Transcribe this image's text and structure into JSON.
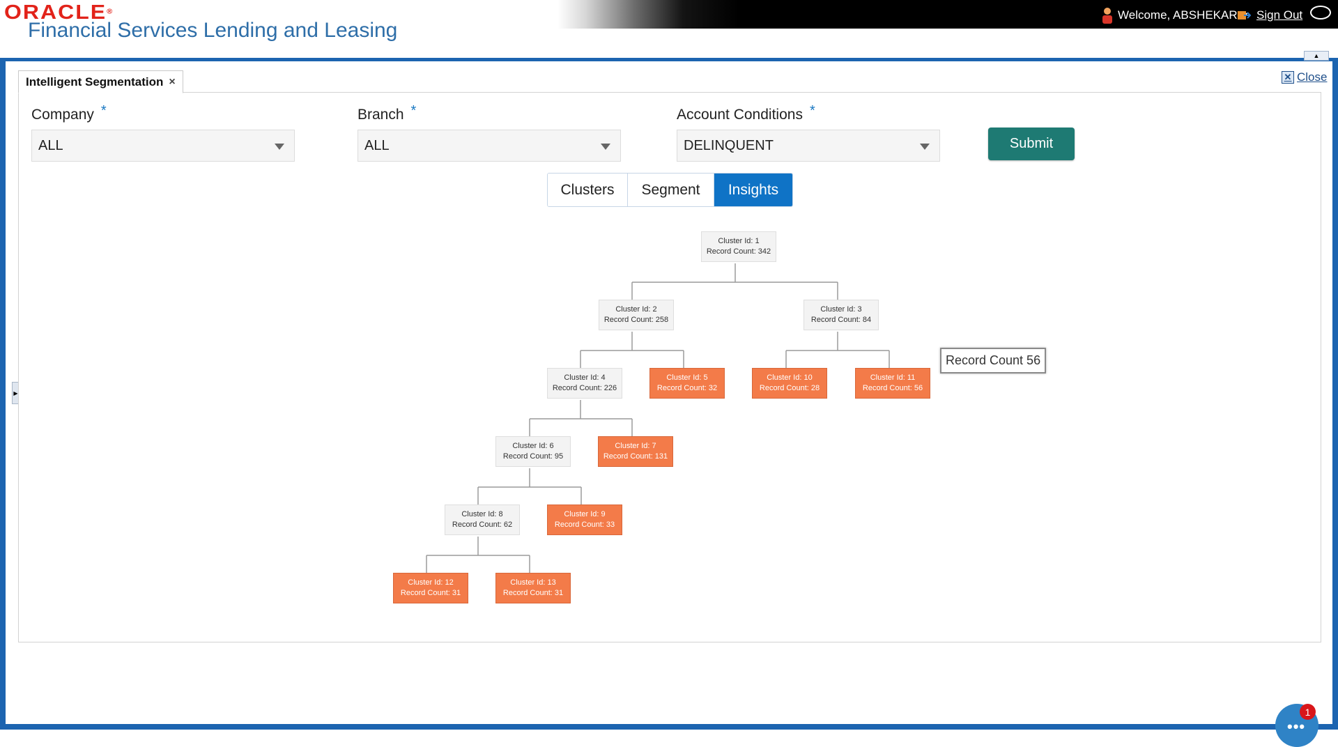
{
  "header": {
    "brand": "ORACLE",
    "product": "Financial Services Lending and Leasing",
    "welcome": "Welcome, ABSHEKAR",
    "sign_out": "Sign Out"
  },
  "tab": {
    "title": "Intelligent Segmentation",
    "close_glyph": "×"
  },
  "close_link": "Close",
  "form": {
    "company": {
      "label": "Company",
      "value": "ALL"
    },
    "branch": {
      "label": "Branch",
      "value": "ALL"
    },
    "account_conditions": {
      "label": "Account Conditions",
      "value": "DELINQUENT"
    },
    "required_marker": "*",
    "submit": "Submit"
  },
  "view_tabs": [
    {
      "label": "Clusters",
      "active": false
    },
    {
      "label": "Segment",
      "active": false
    },
    {
      "label": "Insights",
      "active": true
    }
  ],
  "tree": {
    "nodes": [
      {
        "id": "Cluster Id: 1",
        "count": "Record Count: 342",
        "style": "grey"
      },
      {
        "id": "Cluster Id: 2",
        "count": "Record Count: 258",
        "style": "grey"
      },
      {
        "id": "Cluster Id: 3",
        "count": "Record Count: 84",
        "style": "grey"
      },
      {
        "id": "Cluster Id: 4",
        "count": "Record Count: 226",
        "style": "grey"
      },
      {
        "id": "Cluster Id: 5",
        "count": "Record Count: 32",
        "style": "orange"
      },
      {
        "id": "Cluster Id: 10",
        "count": "Record Count: 28",
        "style": "orange"
      },
      {
        "id": "Cluster Id: 11",
        "count": "Record Count: 56",
        "style": "orange"
      },
      {
        "id": "Cluster Id: 6",
        "count": "Record Count: 95",
        "style": "grey"
      },
      {
        "id": "Cluster Id: 7",
        "count": "Record Count: 131",
        "style": "orange"
      },
      {
        "id": "Cluster Id: 8",
        "count": "Record Count: 62",
        "style": "grey"
      },
      {
        "id": "Cluster Id: 9",
        "count": "Record Count: 33",
        "style": "orange"
      },
      {
        "id": "Cluster Id: 12",
        "count": "Record Count: 31",
        "style": "orange"
      },
      {
        "id": "Cluster Id: 13",
        "count": "Record Count: 31",
        "style": "orange"
      }
    ],
    "tooltip": "Record Count 56"
  },
  "chat": {
    "badge": "1",
    "dots": "•••"
  },
  "colors": {
    "brand_red": "#e2231a",
    "frame_blue": "#1c64b0",
    "submit_teal": "#1e7a73",
    "active_tab": "#0f73c6",
    "leaf_orange": "#f37b49"
  }
}
